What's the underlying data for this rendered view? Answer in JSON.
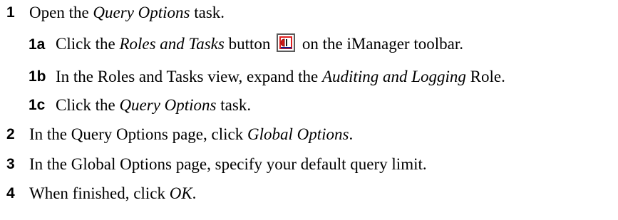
{
  "steps": [
    {
      "num": "1",
      "parts": [
        {
          "text": "Open the ",
          "italic": false
        },
        {
          "text": "Query Options",
          "italic": true
        },
        {
          "text": " task.",
          "italic": false
        }
      ]
    },
    {
      "num": "1a",
      "sub": true,
      "parts": [
        {
          "text": "Click the ",
          "italic": false
        },
        {
          "text": "Roles and Tasks",
          "italic": true
        },
        {
          "text": " button ",
          "italic": false
        },
        {
          "icon": "roles-and-tasks-icon"
        },
        {
          "text": " on the iManager toolbar.",
          "italic": false
        }
      ]
    },
    {
      "num": "1b",
      "sub": true,
      "parts": [
        {
          "text": "In the Roles and Tasks view, expand the ",
          "italic": false
        },
        {
          "text": "Auditing and Logging",
          "italic": true
        },
        {
          "text": " Role.",
          "italic": false
        }
      ]
    },
    {
      "num": "1c",
      "sub": true,
      "parts": [
        {
          "text": "Click the ",
          "italic": false
        },
        {
          "text": "Query Options",
          "italic": true
        },
        {
          "text": " task.",
          "italic": false
        }
      ]
    },
    {
      "num": "2",
      "parts": [
        {
          "text": "In the Query Options page, click ",
          "italic": false
        },
        {
          "text": "Global Options",
          "italic": true
        },
        {
          "text": ".",
          "italic": false
        }
      ]
    },
    {
      "num": "3",
      "parts": [
        {
          "text": "In the Global Options page, specify your default query limit.",
          "italic": false
        }
      ]
    },
    {
      "num": "4",
      "parts": [
        {
          "text": "When finished, click ",
          "italic": false
        },
        {
          "text": "OK",
          "italic": true
        },
        {
          "text": ".",
          "italic": false
        }
      ]
    }
  ]
}
